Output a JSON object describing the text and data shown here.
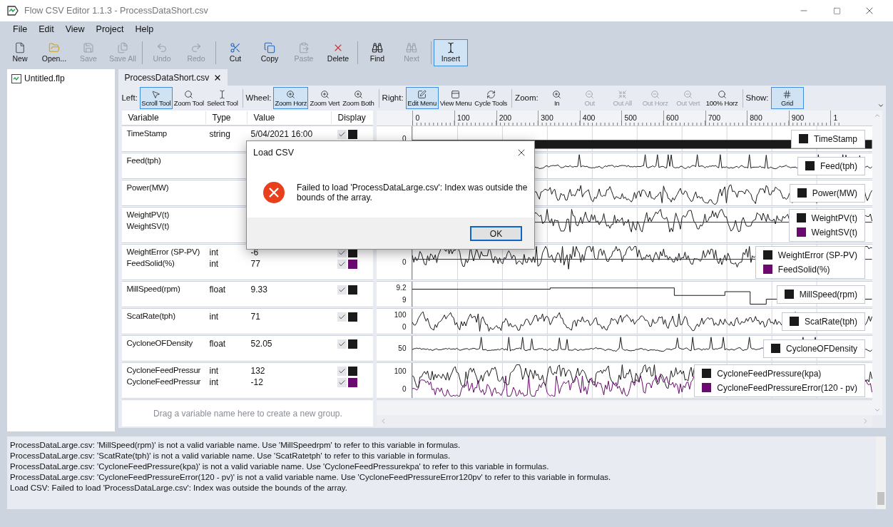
{
  "window": {
    "title": "Flow CSV Editor 1.1.3 - ProcessDataShort.csv"
  },
  "menu": [
    "File",
    "Edit",
    "View",
    "Project",
    "Help"
  ],
  "toolbar": {
    "groups": [
      [
        {
          "label": "New",
          "disabled": false,
          "selected": false
        },
        {
          "label": "Open...",
          "disabled": false,
          "selected": false
        },
        {
          "label": "Save",
          "disabled": true,
          "selected": false
        },
        {
          "label": "Save All",
          "disabled": true,
          "selected": false
        }
      ],
      [
        {
          "label": "Undo",
          "disabled": true,
          "selected": false
        },
        {
          "label": "Redo",
          "disabled": true,
          "selected": false
        }
      ],
      [
        {
          "label": "Cut",
          "disabled": false,
          "selected": false
        },
        {
          "label": "Copy",
          "disabled": false,
          "selected": false
        },
        {
          "label": "Paste",
          "disabled": true,
          "selected": false
        },
        {
          "label": "Delete",
          "disabled": false,
          "selected": false
        }
      ],
      [
        {
          "label": "Find",
          "disabled": false,
          "selected": false
        },
        {
          "label": "Next",
          "disabled": true,
          "selected": false
        }
      ],
      [
        {
          "label": "Insert",
          "disabled": false,
          "selected": true
        }
      ]
    ]
  },
  "sidebar": {
    "items": [
      {
        "label": "Untitled.flp"
      }
    ]
  },
  "tabs": [
    {
      "label": "ProcessDataShort.csv",
      "selected": true
    }
  ],
  "chart_toolbar": {
    "sections": [
      {
        "label": "Left:",
        "buttons": [
          {
            "label": "Scroll Tool",
            "selected": true,
            "disabled": false
          },
          {
            "label": "Zoom Tool",
            "selected": false,
            "disabled": false
          },
          {
            "label": "Select Tool",
            "selected": false,
            "disabled": false
          }
        ]
      },
      {
        "label": "Wheel:",
        "buttons": [
          {
            "label": "Zoom Horz",
            "selected": true,
            "disabled": false
          },
          {
            "label": "Zoom Vert",
            "selected": false,
            "disabled": false
          },
          {
            "label": "Zoom Both",
            "selected": false,
            "disabled": false
          }
        ]
      },
      {
        "label": "Right:",
        "buttons": [
          {
            "label": "Edit Menu",
            "selected": true,
            "disabled": false
          },
          {
            "label": "View Menu",
            "selected": false,
            "disabled": false
          },
          {
            "label": "Cycle Tools",
            "selected": false,
            "disabled": false
          }
        ]
      },
      {
        "label": "Zoom:",
        "buttons": [
          {
            "label": "In",
            "selected": false,
            "disabled": false
          },
          {
            "label": "Out",
            "selected": false,
            "disabled": true
          },
          {
            "label": "Out All",
            "selected": false,
            "disabled": true
          },
          {
            "label": "Out Horz",
            "selected": false,
            "disabled": true
          },
          {
            "label": "Out Vert",
            "selected": false,
            "disabled": true
          },
          {
            "label": "100% Horz",
            "selected": false,
            "disabled": false
          }
        ]
      },
      {
        "label": "Show:",
        "buttons": [
          {
            "label": "Grid",
            "selected": true,
            "disabled": false
          }
        ]
      }
    ]
  },
  "variables": {
    "columns": [
      "Variable",
      "Type",
      "Value",
      "Display"
    ],
    "groups": [
      {
        "rows": [
          {
            "name": "TimeStamp",
            "type": "string",
            "value": "5/04/2021 16:00",
            "checked": true,
            "color": "#1a1a1a"
          }
        ]
      },
      {
        "rows": [
          {
            "name": "Feed(tph)"
          }
        ]
      },
      {
        "rows": [
          {
            "name": "Power(MW)"
          }
        ]
      },
      {
        "rows": [
          {
            "name": "WeightPV(t)"
          },
          {
            "name": "WeightSV(t)"
          }
        ]
      },
      {
        "rows": [
          {
            "name": "WeightError (SP-PV)",
            "type": "int",
            "value": "-6",
            "checked": true,
            "color": "#1a1a1a"
          },
          {
            "name": "FeedSolid(%)",
            "type": "int",
            "value": "77",
            "checked": true,
            "color": "#6a0a6e"
          }
        ]
      },
      {
        "rows": [
          {
            "name": "MillSpeed(rpm)",
            "type": "float",
            "value": "9.33",
            "checked": true,
            "color": "#1a1a1a"
          }
        ]
      },
      {
        "rows": [
          {
            "name": "ScatRate(tph)",
            "type": "int",
            "value": "71",
            "checked": true,
            "color": "#1a1a1a"
          }
        ]
      },
      {
        "rows": [
          {
            "name": "CycloneOFDensity",
            "type": "float",
            "value": "52.05",
            "checked": true,
            "color": "#1a1a1a"
          }
        ]
      },
      {
        "rows": [
          {
            "name": "CycloneFeedPressur",
            "type": "int",
            "value": "132",
            "checked": true,
            "color": "#1a1a1a"
          },
          {
            "name": "CycloneFeedPressur",
            "type": "int",
            "value": "-12",
            "checked": true,
            "color": "#6a0a6e"
          }
        ]
      }
    ],
    "drop_hint": "Drag a variable name here to create a new group."
  },
  "plot": {
    "ruler": [
      "0",
      "100",
      "200",
      "300",
      "400",
      "500",
      "600",
      "700",
      "800",
      "900",
      "1"
    ],
    "lanes": [
      {
        "axis": [
          "0"
        ],
        "legend": [
          {
            "name": "TimeStamp",
            "color": "#1a1a1a",
            "kind": "bar"
          }
        ]
      },
      {
        "legend": [
          {
            "name": "Feed(tph)",
            "color": "#1a1a1a",
            "kind": "spiky"
          }
        ]
      },
      {
        "legend": [
          {
            "name": "Power(MW)",
            "color": "#1a1a1a",
            "kind": "noisy"
          }
        ]
      },
      {
        "legend": [
          {
            "name": "WeightPV(t)",
            "color": "#1a1a1a",
            "kind": "noisy"
          },
          {
            "name": "WeightSV(t)",
            "color": "#6a0a6e",
            "kind": "flat"
          }
        ]
      },
      {
        "axis": [
          "0"
        ],
        "legend": [
          {
            "name": "WeightError (SP-PV)",
            "color": "#1a1a1a",
            "kind": "noisy"
          },
          {
            "name": "FeedSolid(%)",
            "color": "#6a0a6e",
            "kind": "flat"
          }
        ]
      },
      {
        "axis": [
          "9.2",
          "9"
        ],
        "legend": [
          {
            "name": "MillSpeed(rpm)",
            "color": "#1a1a1a",
            "kind": "step"
          }
        ]
      },
      {
        "axis": [
          "100",
          "0"
        ],
        "legend": [
          {
            "name": "ScatRate(tph)",
            "color": "#1a1a1a",
            "kind": "noisy"
          }
        ]
      },
      {
        "axis": [
          "50"
        ],
        "legend": [
          {
            "name": "CycloneOFDensity",
            "color": "#1a1a1a",
            "kind": "spiky"
          }
        ]
      },
      {
        "axis": [
          "100",
          "0"
        ],
        "legend": [
          {
            "name": "CycloneFeedPressure(kpa)",
            "color": "#1a1a1a",
            "kind": "noisy"
          },
          {
            "name": "CycloneFeedPressureError(120 - pv)",
            "color": "#6a0a6e",
            "kind": "noisy"
          }
        ]
      }
    ]
  },
  "dialog": {
    "title": "Load CSV",
    "message": "Failed to load 'ProcessDataLarge.csv': Index was outside the bounds of the array.",
    "buttons": [
      "OK"
    ]
  },
  "log": {
    "lines": [
      "ProcessDataLarge.csv: 'MillSpeed(rpm)' is not a valid variable name. Use 'MillSpeedrpm' to refer to this variable in formulas.",
      "ProcessDataLarge.csv: 'ScatRate(tph)' is not a valid variable name. Use 'ScatRatetph' to refer to this variable in formulas.",
      "ProcessDataLarge.csv: 'CycloneFeedPressure(kpa)' is not a valid variable name. Use 'CycloneFeedPressurekpa' to refer to this variable in formulas.",
      "ProcessDataLarge.csv: 'CycloneFeedPressureError(120 - pv)' is not a valid variable name. Use 'CycloneFeedPressureError120pv' to refer to this variable in formulas.",
      "Load CSV: Failed to load 'ProcessDataLarge.csv': Index was outside the bounds of the array."
    ]
  }
}
